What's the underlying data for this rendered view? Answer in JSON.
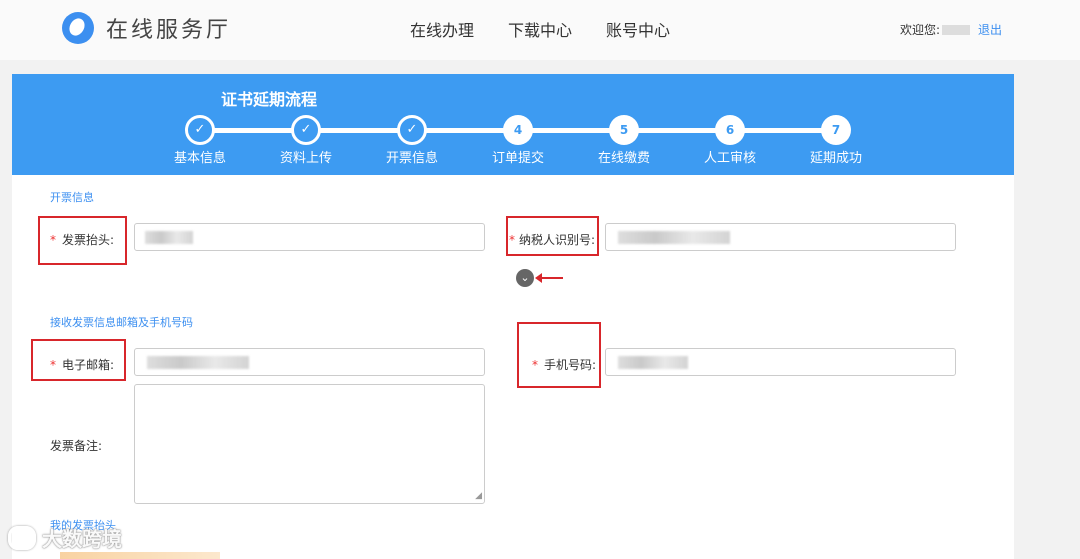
{
  "header": {
    "logo_text": "在线服务厅",
    "nav": [
      "在线办理",
      "下载中心",
      "账号中心"
    ],
    "welcome": "欢迎您:",
    "logout": "退出"
  },
  "process": {
    "title": "证书延期流程",
    "steps": [
      {
        "mark": "✓",
        "label": "基本信息"
      },
      {
        "mark": "✓",
        "label": "资料上传"
      },
      {
        "mark": "✓",
        "label": "开票信息"
      },
      {
        "mark": "4",
        "label": "订单提交"
      },
      {
        "mark": "5",
        "label": "在线缴费"
      },
      {
        "mark": "6",
        "label": "人工审核"
      },
      {
        "mark": "7",
        "label": "延期成功"
      }
    ],
    "current_step": 3
  },
  "form": {
    "invoice_section": "开票信息",
    "invoice_title_label": "发票抬头:",
    "taxpayer_id_label": "纳税人识别号:",
    "expand_icon": "chevron-down-icon",
    "contact_section": "接收发票信息邮箱及手机号码",
    "email_label": "电子邮箱:",
    "phone_label": "手机号码:",
    "remark_label": "发票备注:",
    "my_titles_section": "我的发票抬头"
  },
  "watermark": "大数跨境",
  "colors": {
    "accent": "#3d9bf2",
    "highlight": "#d8262b",
    "required": "#e33"
  }
}
